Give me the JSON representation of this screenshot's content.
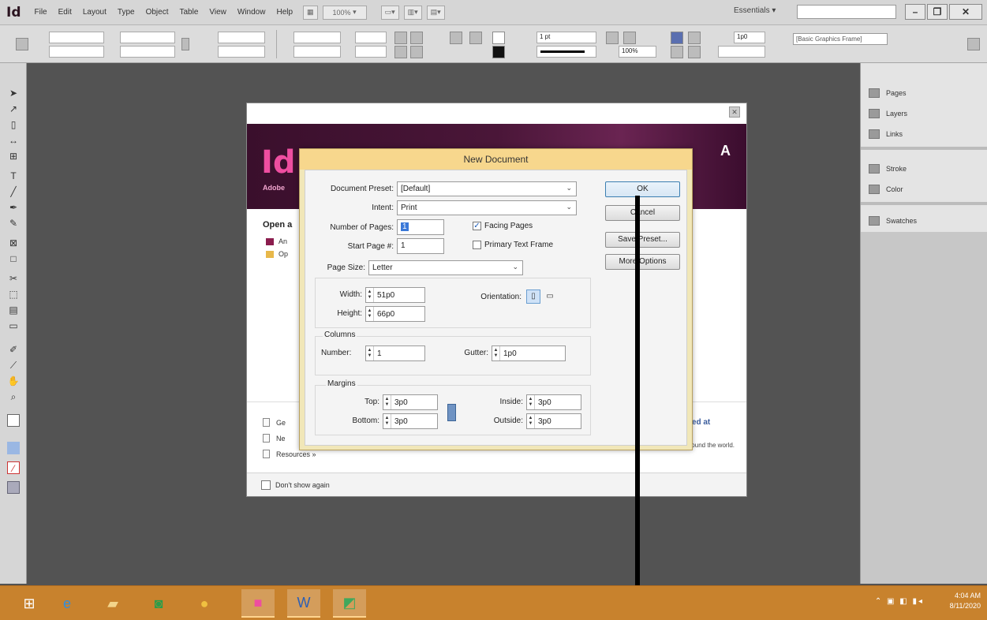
{
  "app": {
    "logo": "Id",
    "menu": [
      "File",
      "Edit",
      "Layout",
      "Type",
      "Object",
      "Table",
      "View",
      "Window",
      "Help"
    ],
    "zoom": "100%",
    "workspace": "Essentials",
    "window_controls": [
      "–",
      "❐",
      "✕"
    ]
  },
  "controlbar": {
    "stroke_weight": "1 pt",
    "zoom_field": "100%",
    "frame_style": "[Basic Graphics Frame]",
    "pt_value": "1p0"
  },
  "right_panel": {
    "items": [
      "Pages",
      "Layers",
      "Links",
      "Stroke",
      "Color",
      "Swatches"
    ]
  },
  "welcome": {
    "logo": "Id",
    "subtitle": "Adobe",
    "open_heading": "Open a",
    "open_items": [
      "An",
      "Op"
    ],
    "bottom_items": [
      "Ge",
      "Ne",
      "Resources »"
    ],
    "right_link": "red at",
    "right_text": "and labs led by expert speakers from around the world.",
    "dont_show": "Don't show again"
  },
  "new_document": {
    "title": "New Document",
    "document_preset_label": "Document Preset:",
    "document_preset_value": "[Default]",
    "intent_label": "Intent:",
    "intent_value": "Print",
    "number_of_pages_label": "Number of Pages:",
    "number_of_pages_value": "1",
    "start_page_label": "Start Page #:",
    "start_page_value": "1",
    "facing_pages_label": "Facing Pages",
    "facing_pages_checked": true,
    "primary_text_frame_label": "Primary Text Frame",
    "primary_text_frame_checked": false,
    "page_size_label": "Page Size:",
    "page_size_value": "Letter",
    "width_label": "Width:",
    "width_value": "51p0",
    "height_label": "Height:",
    "height_value": "66p0",
    "orientation_label": "Orientation:",
    "columns_group": "Columns",
    "number_label": "Number:",
    "number_value": "1",
    "gutter_label": "Gutter:",
    "gutter_value": "1p0",
    "margins_group": "Margins",
    "top_label": "Top:",
    "top_value": "3p0",
    "bottom_label": "Bottom:",
    "bottom_value": "3p0",
    "inside_label": "Inside:",
    "inside_value": "3p0",
    "outside_label": "Outside:",
    "outside_value": "3p0",
    "buttons": {
      "ok": "OK",
      "cancel": "Cancel",
      "save_preset": "Save Preset...",
      "more_options": "More Options"
    }
  },
  "taskbar": {
    "clock_time": "4:04 AM",
    "clock_date": "8/11/2020"
  }
}
